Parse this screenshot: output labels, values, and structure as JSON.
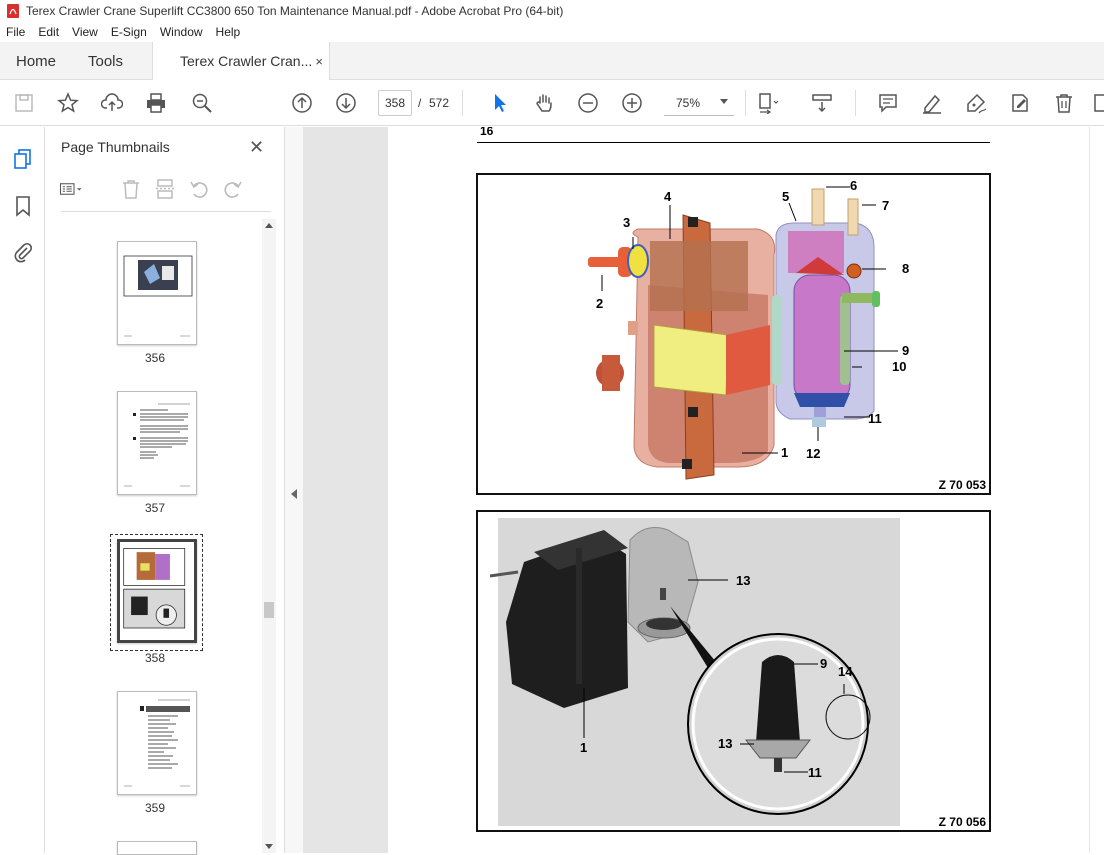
{
  "window": {
    "title": "Terex Crawler Crane Superlift CC3800 650 Ton Maintenance Manual.pdf - Adobe Acrobat Pro (64-bit)"
  },
  "menu": [
    "File",
    "Edit",
    "View",
    "E-Sign",
    "Window",
    "Help"
  ],
  "tabs": {
    "home": "Home",
    "tools": "Tools",
    "document": "Terex Crawler Cran...",
    "close": "×"
  },
  "toolbar": {
    "current_page": "358",
    "separator": "/",
    "total_pages": "572",
    "zoom": "75%"
  },
  "thumbnails_panel": {
    "title": "Page Thumbnails",
    "close": "✕",
    "pages": [
      {
        "label": "356"
      },
      {
        "label": "357"
      },
      {
        "label": "358",
        "selected": true
      },
      {
        "label": "359"
      }
    ]
  },
  "document_page": {
    "page_number": "16",
    "figures": [
      {
        "caption": "Z 70 053",
        "callouts": [
          "1",
          "2",
          "3",
          "4",
          "5",
          "6",
          "7",
          "8",
          "9",
          "10",
          "11",
          "12"
        ]
      },
      {
        "caption": "Z 70 056",
        "callouts": [
          "1",
          "13",
          "9",
          "14",
          "13",
          "11"
        ]
      }
    ]
  },
  "colors": {
    "accent": "#1473e6",
    "pdf_icon": "#d7312f",
    "viewer_bg": "#e5e5e5"
  }
}
